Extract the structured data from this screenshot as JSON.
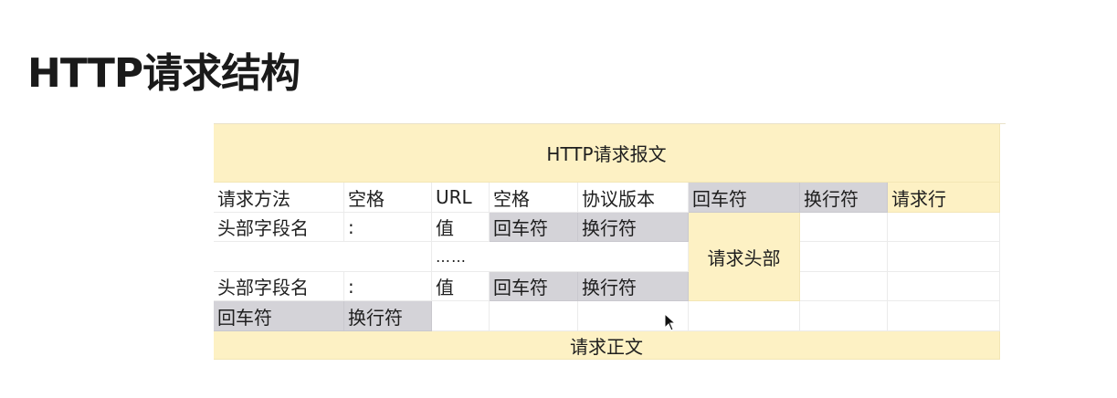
{
  "page": {
    "title": "HTTP请求结构"
  },
  "table": {
    "message": "HTTP请求报文",
    "request_line": {
      "method": "请求方法",
      "space1": "空格",
      "url": "URL",
      "space2": "空格",
      "version": "协议版本",
      "cr": "回车符",
      "lf": "换行符",
      "label": "请求行"
    },
    "header_row_1": {
      "field_name": "头部字段名",
      "colon": ":",
      "value": "值",
      "cr": "回车符",
      "lf": "换行符"
    },
    "ellipsis": "……",
    "header_row_2": {
      "field_name": "头部字段名",
      "colon": ":",
      "value": "值",
      "cr": "回车符",
      "lf": "换行符"
    },
    "headers_label": "请求头部",
    "blank_line": {
      "cr": "回车符",
      "lf": "换行符"
    },
    "body_label": "请求正文"
  },
  "colors": {
    "yellow": "#fdf1c4",
    "gray": "#d4d3d8"
  }
}
